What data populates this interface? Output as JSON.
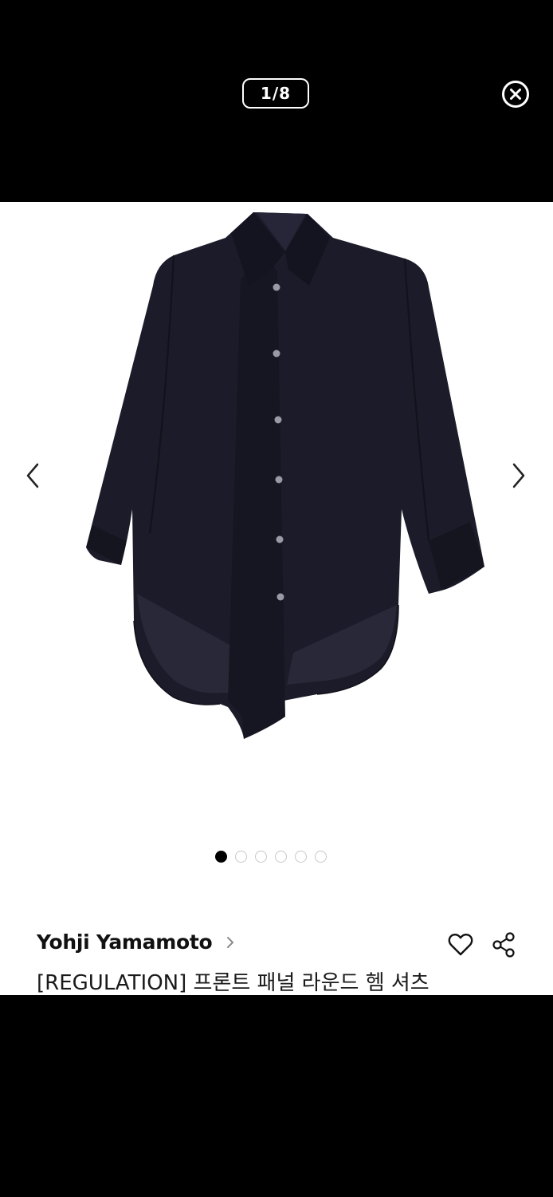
{
  "viewer": {
    "counter": "1/8"
  },
  "carousel": {
    "dot_count": 6,
    "active_dot": 1
  },
  "product": {
    "brand": "Yohji Yamamoto",
    "title": "[REGULATION] 프론트 패널 라운드 헴 셔츠",
    "image_alt": "black asymmetric front panel round hem shirt"
  },
  "icons": {
    "close": "close-circle-icon",
    "prev": "chevron-left-icon",
    "next": "chevron-right-icon",
    "brand_link": "chevron-right-icon",
    "like": "heart-icon",
    "share": "share-icon"
  },
  "colors": {
    "overlay": "#000000",
    "surface": "#ffffff",
    "garment": "#1b1b29",
    "text": "#111111",
    "dot_inactive": "#c8c8c8"
  }
}
